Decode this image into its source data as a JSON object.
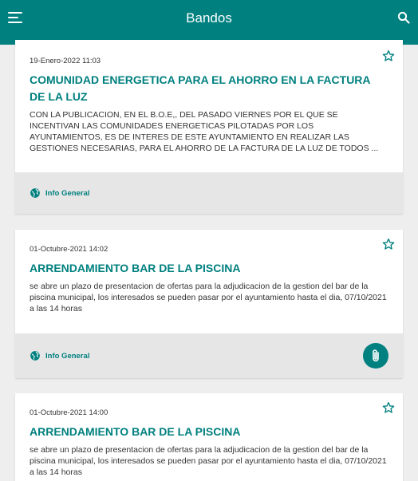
{
  "header": {
    "title": "Bandos",
    "menu_icon": "menu-icon",
    "search_icon": "search-icon",
    "accent": "#00807f"
  },
  "cards": [
    {
      "date": "19-Enero-2022 11:03",
      "title": "COMUNIDAD ENERGETICA PARA EL AHORRO EN LA FACTURA DE LA LUZ",
      "body": "CON LA PUBLICACION,  EN EL B.O.E,,  DEL PASADO VIERNES POR EL QUE SE INCENTIVAN LAS COMUNIDADES ENERGETICAS  PILOTADAS POR LOS AYUNTAMIENTOS, ES DE INTERES DE ESTE AYUNTAMIENTO  EN REALIZAR LAS GESTIONES NECESARIAS,  PARA EL AHORRO DE LA FACTURA DE LA LUZ DE TODOS ...",
      "category": "Info General",
      "has_attachment": false
    },
    {
      "date": "01-Octubre-2021 14:02",
      "title": "ARRENDAMIENTO  BAR  DE LA PISCINA",
      "body": "se abre un plazo de presentacion de ofertas para la adjudicacion de la gestion del bar de la piscina municipal, los interesados se pueden pasar por el ayuntamiento hasta el dia, 07/10/2021 a las 14 horas",
      "category": "Info General",
      "has_attachment": true
    },
    {
      "date": "01-Octubre-2021 14:00",
      "title": "ARRENDAMIENTO  BAR  DE LA PISCINA",
      "body": "se abre un plazo de presentacion de ofertas para la adjudicacion de la gestion del bar de la piscina municipal, los interesados se pueden pasar por el ayuntamiento hasta el dia, 07/10/2021 a las 14 horas"
    }
  ]
}
